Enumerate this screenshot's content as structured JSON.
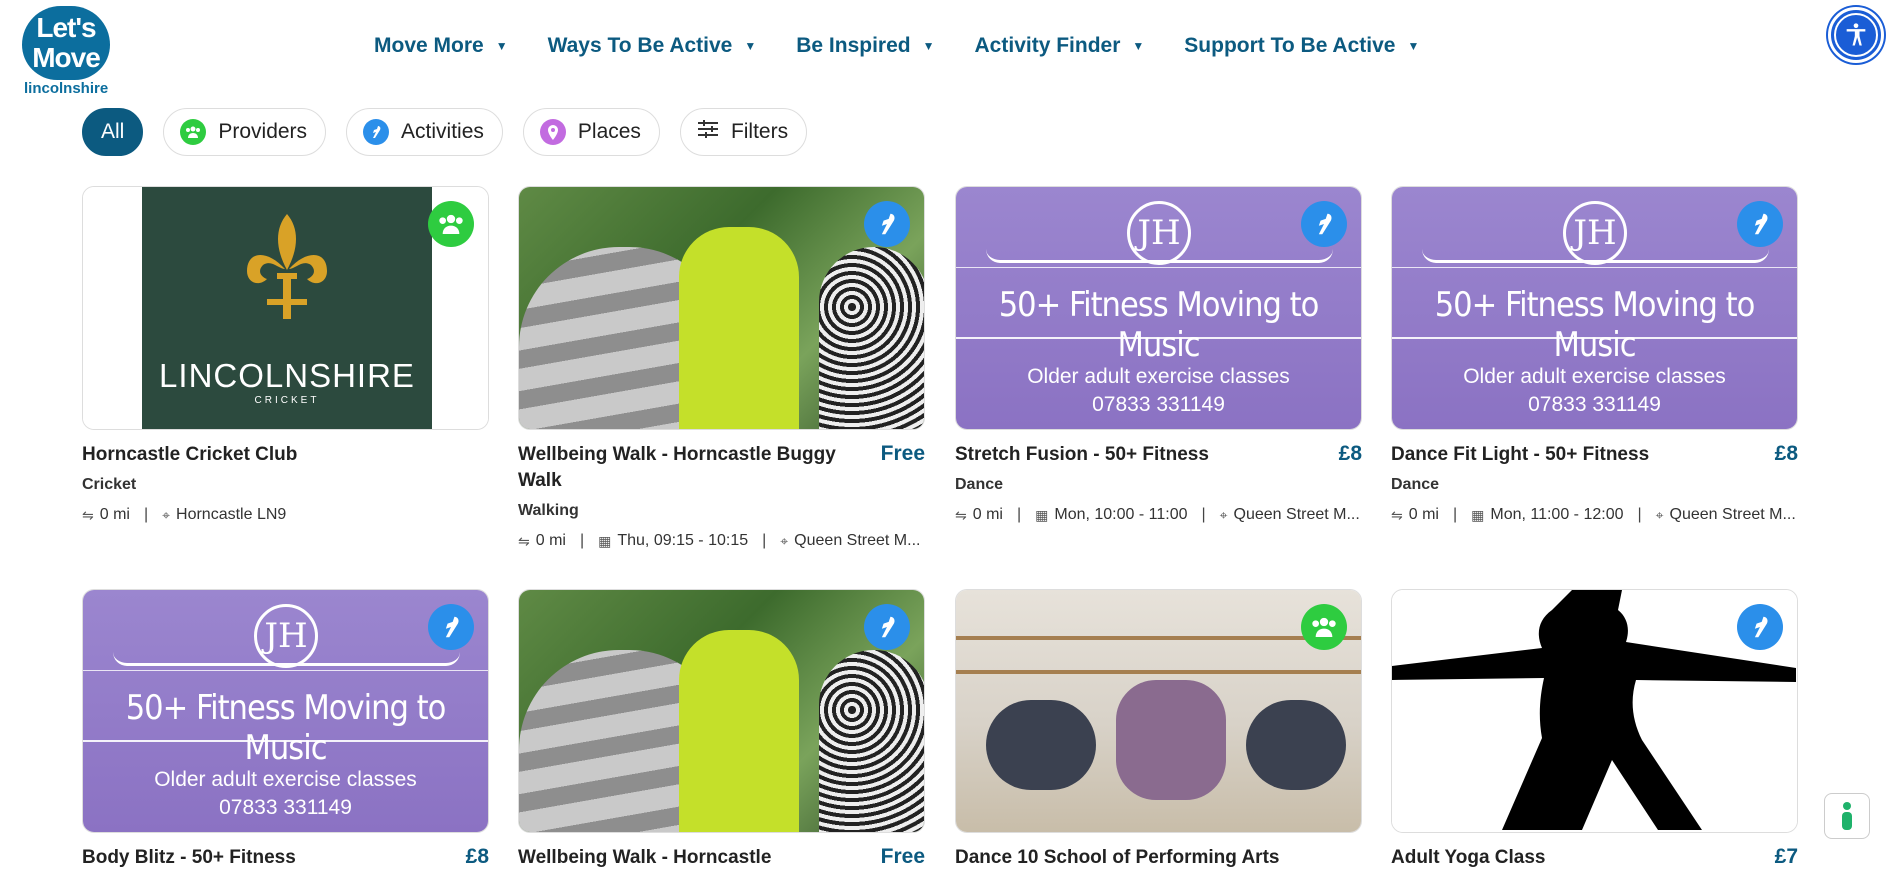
{
  "logo": {
    "line1": "Let's",
    "line2": "Move",
    "sub": "lincolnshire"
  },
  "nav": [
    {
      "label": "Move More"
    },
    {
      "label": "Ways To Be Active"
    },
    {
      "label": "Be Inspired"
    },
    {
      "label": "Activity Finder"
    },
    {
      "label": "Support To Be Active"
    }
  ],
  "filters": {
    "all": "All",
    "providers": "Providers",
    "activities": "Activities",
    "places": "Places",
    "filters": "Filters"
  },
  "colors": {
    "brand": "#0c5a80",
    "provider_badge": "#2ecc40",
    "activity_badge": "#2b8fea",
    "accessibility": "#1a5dd6"
  },
  "thumb_text": {
    "lincs": "LINCOLNSHIRE",
    "lincs_sub": "CRICKET",
    "jh": "JH",
    "fitness_title": "50+ Fitness Moving to Music",
    "fitness_sub1": "Older adult exercise classes",
    "fitness_sub2": "07833 331149"
  },
  "cards": [
    {
      "title": "Horncastle Cricket Club",
      "price": "",
      "category": "Cricket",
      "distance": "0 mi",
      "time": "",
      "location": "Horncastle LN9",
      "badge": "provider"
    },
    {
      "title": "Wellbeing Walk - Horncastle Buggy Walk",
      "price": "Free",
      "category": "Walking",
      "distance": "0 mi",
      "time": "Thu, 09:15 - 10:15",
      "location": "Queen Street M...",
      "badge": "activity"
    },
    {
      "title": "Stretch Fusion - 50+ Fitness",
      "price": "£8",
      "category": "Dance",
      "distance": "0 mi",
      "time": "Mon, 10:00 - 11:00",
      "location": "Queen Street M...",
      "badge": "activity"
    },
    {
      "title": "Dance Fit Light - 50+ Fitness",
      "price": "£8",
      "category": "Dance",
      "distance": "0 mi",
      "time": "Mon, 11:00 - 12:00",
      "location": "Queen Street M...",
      "badge": "activity"
    },
    {
      "title": "Body Blitz - 50+ Fitness",
      "price": "£8",
      "badge": "activity"
    },
    {
      "title": "Wellbeing Walk - Horncastle",
      "price": "Free",
      "badge": "activity"
    },
    {
      "title": "Dance 10 School of Performing Arts",
      "price": "",
      "badge": "provider"
    },
    {
      "title": "Adult Yoga Class",
      "price": "£7",
      "badge": "activity"
    }
  ]
}
